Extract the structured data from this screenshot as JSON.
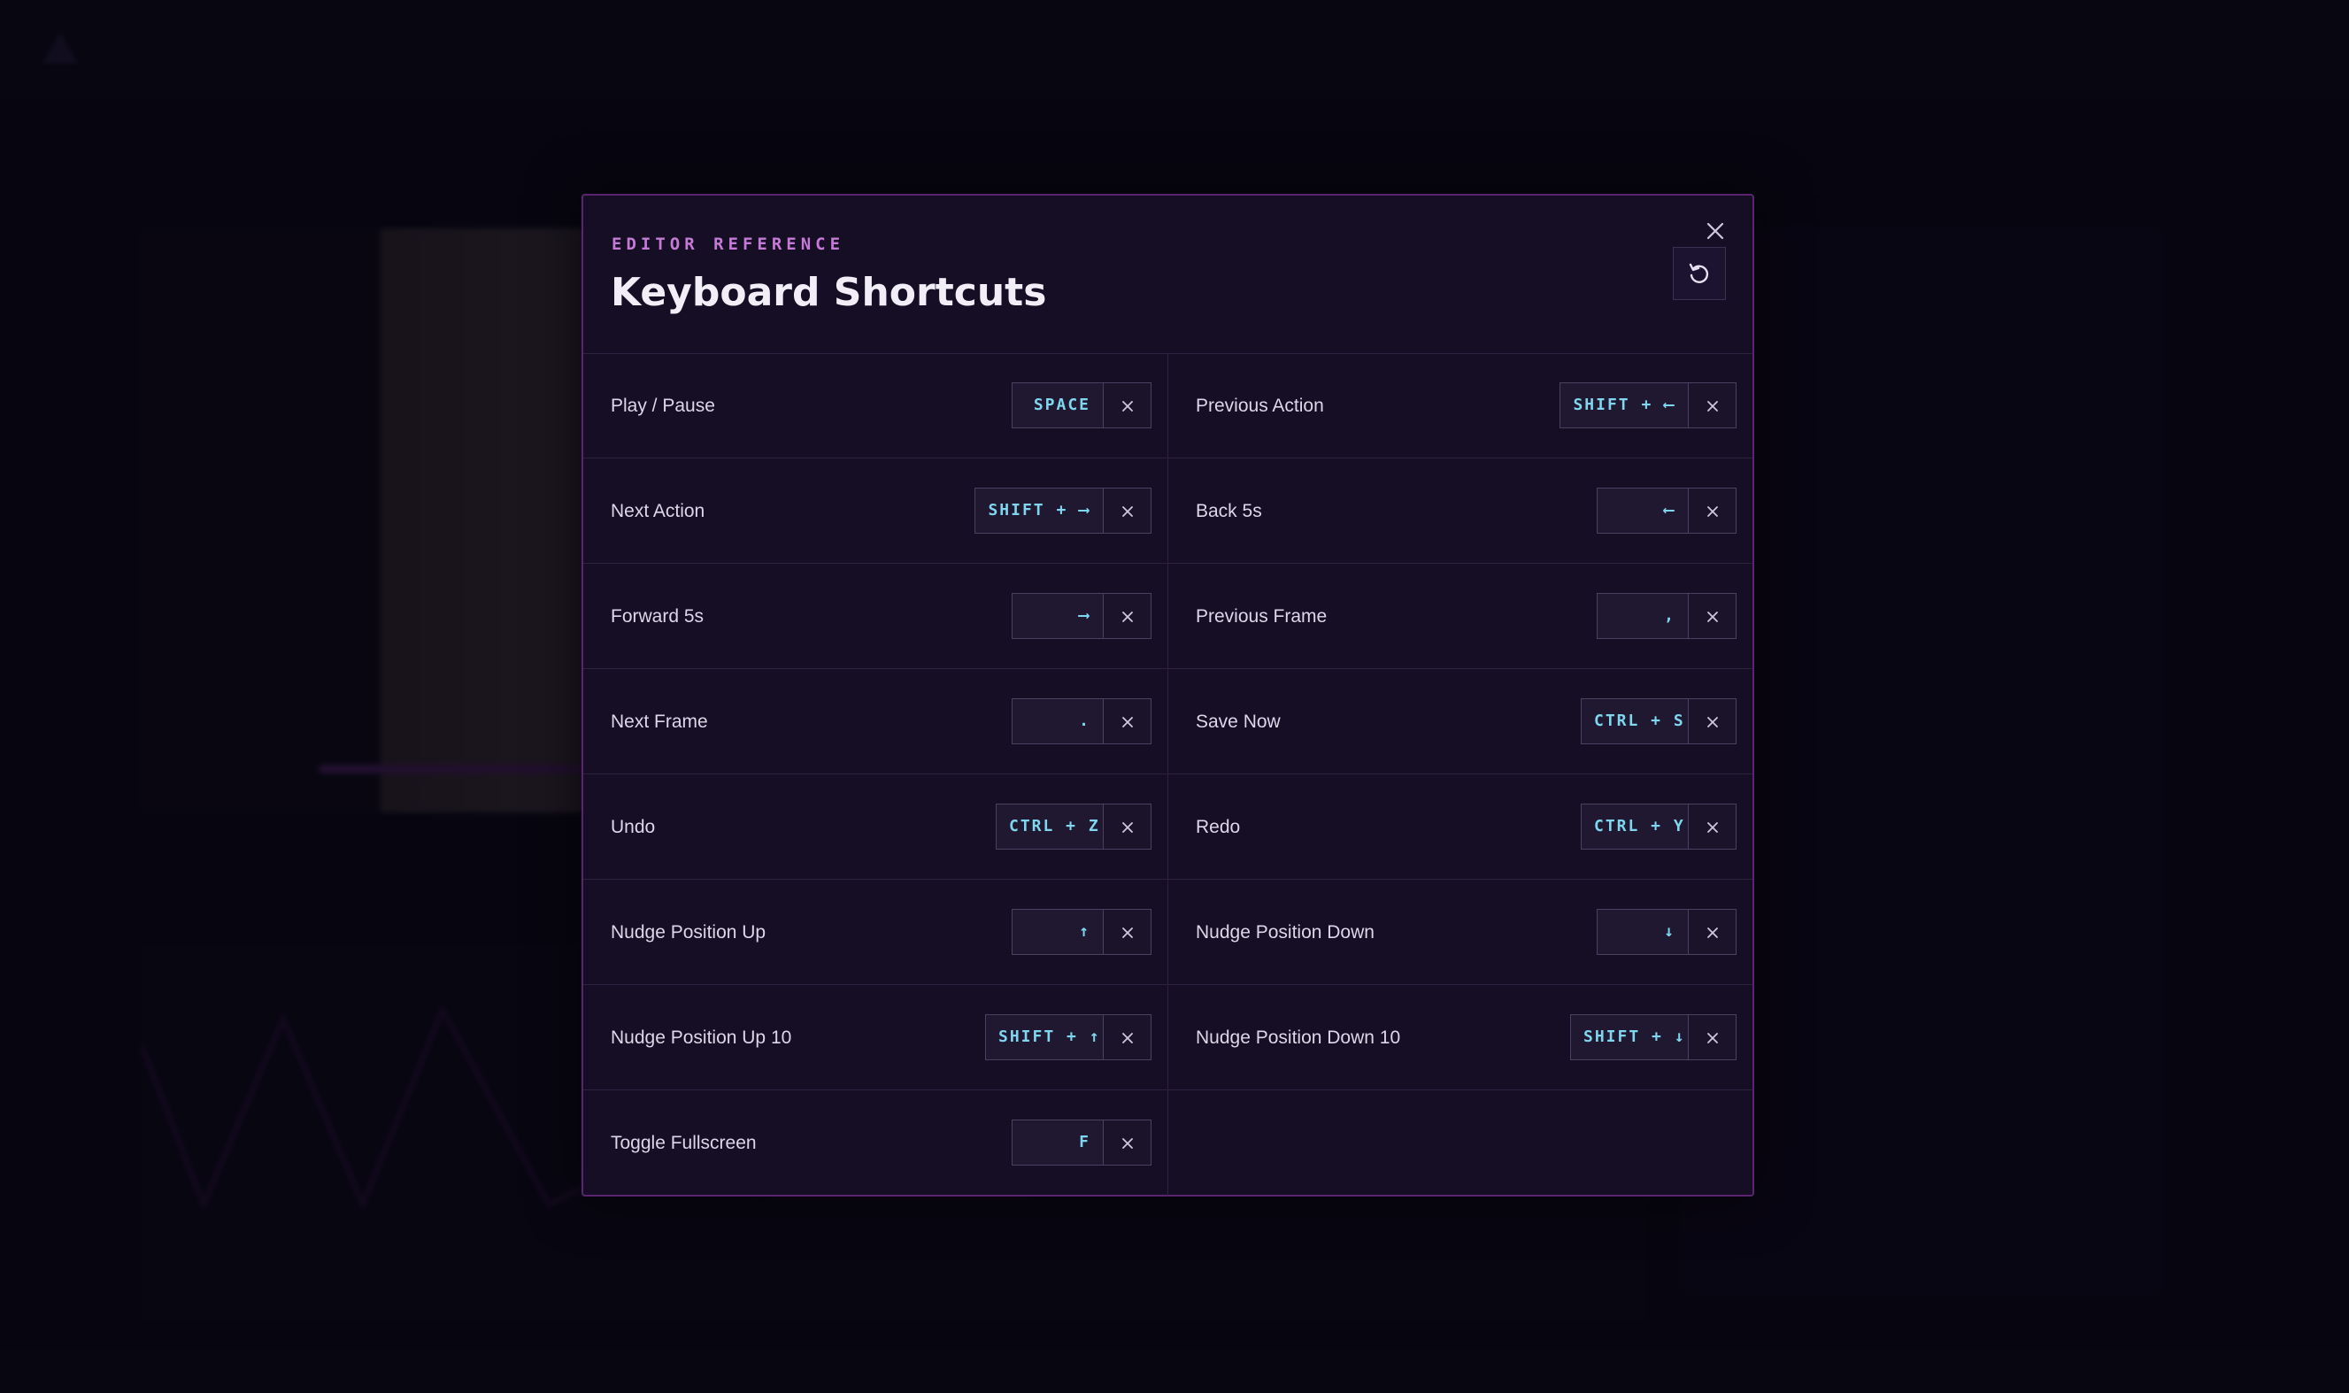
{
  "modal": {
    "eyebrow": "EDITOR REFERENCE",
    "title": "Keyboard Shortcuts",
    "close_icon": "close-icon",
    "reset_icon": "reset-icon"
  },
  "shortcuts": [
    {
      "label": "Play / Pause",
      "key": "SPACE"
    },
    {
      "label": "Previous Action",
      "key": "SHIFT + ⟵"
    },
    {
      "label": "Next Action",
      "key": "SHIFT + ⟶"
    },
    {
      "label": "Back 5s",
      "key": "⟵"
    },
    {
      "label": "Forward 5s",
      "key": "⟶"
    },
    {
      "label": "Previous Frame",
      "key": ","
    },
    {
      "label": "Next Frame",
      "key": "."
    },
    {
      "label": "Save Now",
      "key": "CTRL + S"
    },
    {
      "label": "Undo",
      "key": "CTRL + Z"
    },
    {
      "label": "Redo",
      "key": "CTRL + Y"
    },
    {
      "label": "Nudge Position Up",
      "key": "↑"
    },
    {
      "label": "Nudge Position Down",
      "key": "↓"
    },
    {
      "label": "Nudge Position Up 10",
      "key": "SHIFT + ↑"
    },
    {
      "label": "Nudge Position Down 10",
      "key": "SHIFT + ↓"
    },
    {
      "label": "Toggle Fullscreen",
      "key": "F"
    }
  ],
  "colors": {
    "accent": "#c47ad6",
    "key_text": "#7fd6ee",
    "modal_border": "#5c2470",
    "modal_bg": "#150e24"
  }
}
